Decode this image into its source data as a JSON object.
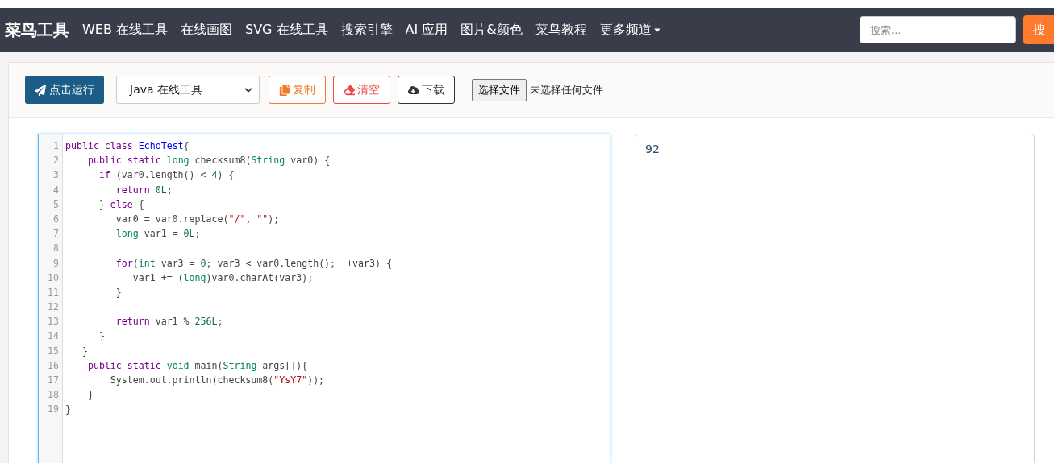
{
  "nav": {
    "logo": "菜鸟工具",
    "items": [
      {
        "label": "WEB 在线工具",
        "dropdown": false
      },
      {
        "label": "在线画图",
        "dropdown": false
      },
      {
        "label": "SVG 在线工具",
        "dropdown": false
      },
      {
        "label": "搜索引擎",
        "dropdown": false
      },
      {
        "label": "AI 应用",
        "dropdown": false
      },
      {
        "label": "图片&颜色",
        "dropdown": false
      },
      {
        "label": "菜鸟教程",
        "dropdown": false
      },
      {
        "label": "更多频道",
        "dropdown": true
      }
    ],
    "search": {
      "placeholder": "搜索..."
    },
    "search_button": "搜"
  },
  "toolbar": {
    "run_button": "点击运行",
    "language_select": "Java 在线工具",
    "buttons": [
      {
        "kind": "copy",
        "label": "复制"
      },
      {
        "kind": "clear",
        "label": "清空"
      },
      {
        "kind": "download",
        "label": "下载"
      }
    ],
    "file_button": "选择文件",
    "file_status": "未选择任何文件"
  },
  "editor": {
    "lines": [
      {
        "number": "1",
        "tokens": [
          {
            "kind": "keyword",
            "text": "public"
          },
          {
            "kind": "keyword",
            "text": " class"
          },
          {
            "kind": "def",
            "text": " EchoTest"
          },
          {
            "kind": "plain",
            "text": "{"
          }
        ]
      },
      {
        "number": "2",
        "tokens": [
          {
            "kind": "keyword",
            "text": "    public"
          },
          {
            "kind": "keyword",
            "text": " static"
          },
          {
            "kind": "type",
            "text": " long"
          },
          {
            "kind": "plain",
            "text": " checksum8("
          },
          {
            "kind": "type",
            "text": "String"
          },
          {
            "kind": "plain",
            "text": " var0) {"
          }
        ]
      },
      {
        "number": "3",
        "tokens": [
          {
            "kind": "keyword",
            "text": "      if"
          },
          {
            "kind": "plain",
            "text": " (var0.length() < "
          },
          {
            "kind": "number",
            "text": "4"
          },
          {
            "kind": "plain",
            "text": ") {"
          }
        ]
      },
      {
        "number": "4",
        "tokens": [
          {
            "kind": "keyword",
            "text": "         return"
          },
          {
            "kind": "number",
            "text": " 0L"
          },
          {
            "kind": "plain",
            "text": ";"
          }
        ]
      },
      {
        "number": "5",
        "tokens": [
          {
            "kind": "plain",
            "text": "      } "
          },
          {
            "kind": "keyword",
            "text": "else"
          },
          {
            "kind": "plain",
            "text": " {"
          }
        ]
      },
      {
        "number": "6",
        "tokens": [
          {
            "kind": "plain",
            "text": "         var0 = var0.replace("
          },
          {
            "kind": "string",
            "text": "\"/\""
          },
          {
            "kind": "plain",
            "text": ", "
          },
          {
            "kind": "string",
            "text": "\"\""
          },
          {
            "kind": "plain",
            "text": ");"
          }
        ]
      },
      {
        "number": "7",
        "tokens": [
          {
            "kind": "type",
            "text": "         long"
          },
          {
            "kind": "plain",
            "text": " var1 = "
          },
          {
            "kind": "number",
            "text": "0L"
          },
          {
            "kind": "plain",
            "text": ";"
          }
        ]
      },
      {
        "number": "8"
      },
      {
        "number": "9",
        "tokens": [
          {
            "kind": "keyword",
            "text": "         for"
          },
          {
            "kind": "plain",
            "text": "("
          },
          {
            "kind": "type",
            "text": "int"
          },
          {
            "kind": "plain",
            "text": " var3 = "
          },
          {
            "kind": "number",
            "text": "0"
          },
          {
            "kind": "plain",
            "text": "; var3 < var0.length(); ++var3) {"
          }
        ]
      },
      {
        "number": "10",
        "tokens": [
          {
            "kind": "plain",
            "text": "            var1 += ("
          },
          {
            "kind": "type",
            "text": "long"
          },
          {
            "kind": "plain",
            "text": ")var0.charAt(var3);"
          }
        ]
      },
      {
        "number": "11",
        "tokens": [
          {
            "kind": "plain",
            "text": "         }"
          }
        ]
      },
      {
        "number": "12"
      },
      {
        "number": "13",
        "tokens": [
          {
            "kind": "keyword",
            "text": "         return"
          },
          {
            "kind": "plain",
            "text": " var1 % "
          },
          {
            "kind": "number",
            "text": "256L"
          },
          {
            "kind": "plain",
            "text": ";"
          }
        ]
      },
      {
        "number": "14",
        "tokens": [
          {
            "kind": "plain",
            "text": "      }"
          }
        ]
      },
      {
        "number": "15",
        "tokens": [
          {
            "kind": "plain",
            "text": "   }"
          }
        ]
      },
      {
        "number": "16",
        "tokens": [
          {
            "kind": "keyword",
            "text": "    public"
          },
          {
            "kind": "keyword",
            "text": " static"
          },
          {
            "kind": "type",
            "text": " void"
          },
          {
            "kind": "plain",
            "text": " main("
          },
          {
            "kind": "type",
            "text": "String"
          },
          {
            "kind": "plain",
            "text": " args[]){"
          }
        ]
      },
      {
        "number": "17",
        "tokens": [
          {
            "kind": "plain",
            "text": "        System.out.println(checksum8("
          },
          {
            "kind": "string",
            "text": "\"YsY7\""
          },
          {
            "kind": "plain",
            "text": "));"
          }
        ]
      },
      {
        "number": "18",
        "tokens": [
          {
            "kind": "plain",
            "text": "    }"
          }
        ]
      },
      {
        "number": "19",
        "tokens": [
          {
            "kind": "plain",
            "text": "}"
          }
        ]
      }
    ]
  },
  "output": {
    "text": "92"
  }
}
